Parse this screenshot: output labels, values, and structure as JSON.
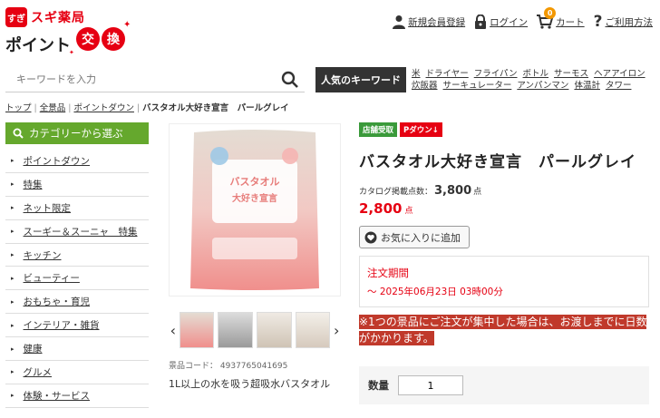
{
  "brand": {
    "badge": "すぎ",
    "name": "スギ薬局",
    "point": "ポイント",
    "koukan": [
      "交",
      "換"
    ]
  },
  "topnav": {
    "register": "新規会員登録",
    "login": "ログイン",
    "cart_count": "0",
    "cart": "カート",
    "guide": "ご利用方法"
  },
  "search": {
    "placeholder": "キーワードを入力"
  },
  "keywords": {
    "title": "人気のキーワード",
    "items": [
      "米",
      "ドライヤー",
      "フライパン",
      "ボトル",
      "サーモス",
      "ヘアアイロン",
      "炊飯器",
      "サーキュレーター",
      "アンパンマン",
      "体温計",
      "タワー"
    ]
  },
  "breadcrumb": {
    "items": [
      "トップ",
      "全景品",
      "ポイントダウン"
    ],
    "current": "バスタオル大好き宣言　パールグレイ"
  },
  "sidebar": {
    "title": "カテゴリーから選ぶ",
    "items": [
      "ポイントダウン",
      "特集",
      "ネット限定",
      "スーギー＆スーニャ　特集",
      "キッチン",
      "ビューティー",
      "おもちゃ・育児",
      "インテリア・雑貨",
      "健康",
      "グルメ",
      "体験・サービス"
    ]
  },
  "product": {
    "image_label": "バスタオル大好き宣言",
    "code_label": "景品コード：",
    "code": "4937765041695",
    "description": "1L以上の水を吸う超吸水バスタオル",
    "tags": [
      "店舗受取",
      "Pダウン↓"
    ],
    "title": "バスタオル大好き宣言　パールグレイ",
    "catalog_label": "カタログ掲載点数：",
    "catalog_points": "3,800",
    "catalog_unit": "点",
    "price": "2,800",
    "price_unit": "点",
    "favorite": "お気に入りに追加",
    "order_label": "注文期間",
    "order_period": "～ 2025年06月23日 03時00分",
    "notice": "※1つの景品にご注文が集中した場合は、お渡しまでに日数がかかります。",
    "qty_label": "数量",
    "qty_value": "1"
  },
  "colors": {
    "brand_red": "#e60012",
    "category_green": "#65a82d",
    "notice_bg": "#c0392b"
  }
}
